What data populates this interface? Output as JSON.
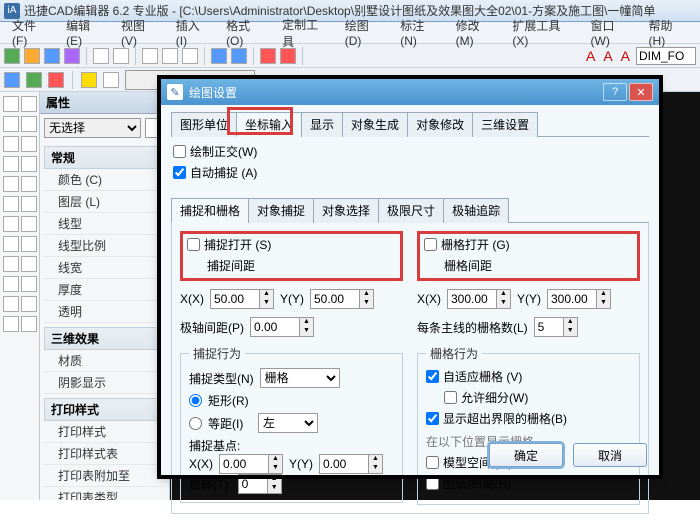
{
  "app_title": "迅捷CAD编辑器 6.2 专业版  - [C:\\Users\\Administrator\\Desktop\\别墅设计图纸及效果图大全02\\01-方案及施工图\\一幢简单",
  "menus": [
    "文件(F)",
    "编辑(E)",
    "视图(V)",
    "插入(I)",
    "格式(O)",
    "定制工具",
    "绘图(D)",
    "标注(N)",
    "修改(M)",
    "扩展工具(X)",
    "窗口(W)",
    "帮助(H)"
  ],
  "toolbar1_input": "DIM_FO",
  "prop": {
    "title": "属性",
    "selector": "无选择",
    "groups": [
      {
        "name": "常规",
        "items": [
          "颜色 (C)",
          "图层 (L)",
          "线型",
          "线型比例",
          "线宽",
          "厚度",
          "透明"
        ]
      },
      {
        "name": "三维效果",
        "items": [
          "材质",
          "阴影显示"
        ]
      },
      {
        "name": "打印样式",
        "items": [
          "打印样式",
          "打印样式表",
          "打印表附加至",
          "打印表类型"
        ]
      }
    ]
  },
  "dlg": {
    "title": "绘图设置",
    "tabs": [
      "图形单位",
      "坐标输入",
      "显示",
      "对象生成",
      "对象修改",
      "三维设置"
    ],
    "active_tab": 1,
    "chk_draw_ortho": "绘制正交(W)",
    "chk_auto_snap": "自动捕捉 (A)",
    "subtabs": [
      "捕捉和栅格",
      "对象捕捉",
      "对象选择",
      "极限尺寸",
      "极轴追踪"
    ],
    "snap_open": "捕捉打开 (S)",
    "snap_spacing": "捕捉间距",
    "grid_open": "栅格打开 (G)",
    "grid_spacing": "栅格间距",
    "xa": "X(X)",
    "ya": "Y(Y)",
    "snap_x": "50.00",
    "snap_y": "50.00",
    "grid_x": "300.00",
    "grid_y": "300.00",
    "polar_dist": "极轴间距(P)",
    "polar_dist_v": "0.00",
    "grid_major": "每条主线的栅格数(L)",
    "grid_major_v": "5",
    "snap_behavior": "捕捉行为",
    "snap_type": "捕捉类型(N)",
    "snap_type_v": "栅格",
    "rect": "矩形(R)",
    "iso": "等距(I)",
    "iso_dir": "左",
    "snap_base": "捕捉基点:",
    "base_x": "0.00",
    "base_y": "0.00",
    "rotate": "旋转(T):",
    "rotate_v": "0",
    "grid_behavior": "栅格行为",
    "adaptive": "自适应栅格 (V)",
    "subdiv": "允许细分(W)",
    "outside": "显示超出界限的栅格(B)",
    "show_in": "在以下位置显示栅格",
    "model": "模型空间 (M)",
    "sheet": "图纸/布局(H)",
    "ok": "确定",
    "cancel": "取消"
  }
}
